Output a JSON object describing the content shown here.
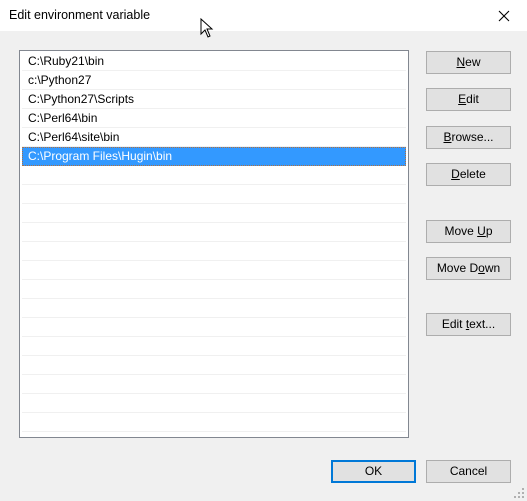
{
  "window": {
    "title": "Edit environment variable",
    "close_icon": "close-icon"
  },
  "list": {
    "items": [
      {
        "label": "C:\\Ruby21\\bin",
        "selected": false
      },
      {
        "label": "c:\\Python27",
        "selected": false
      },
      {
        "label": "C:\\Python27\\Scripts",
        "selected": false
      },
      {
        "label": "C:\\Perl64\\bin",
        "selected": false
      },
      {
        "label": "C:\\Perl64\\site\\bin",
        "selected": false
      },
      {
        "label": "C:\\Program Files\\Hugin\\bin",
        "selected": true
      }
    ],
    "empty_rows": 14,
    "selection_color": "#3399ff"
  },
  "buttons": {
    "new": {
      "pre": "",
      "accel": "N",
      "post": "ew"
    },
    "edit": {
      "pre": "",
      "accel": "E",
      "post": "dit"
    },
    "browse": {
      "pre": "",
      "accel": "B",
      "post": "rowse..."
    },
    "delete": {
      "pre": "",
      "accel": "D",
      "post": "elete"
    },
    "move_up": {
      "pre": "Move ",
      "accel": "U",
      "post": "p"
    },
    "move_down": {
      "pre": "Move D",
      "accel": "o",
      "post": "wn"
    },
    "edit_text": {
      "pre": "Edit ",
      "accel": "t",
      "post": "ext..."
    },
    "ok": {
      "label": "OK"
    },
    "cancel": {
      "label": "Cancel"
    }
  },
  "colors": {
    "accent": "#0078d7",
    "dialog_bg": "#f0f0f0",
    "button_bg": "#e1e1e1"
  }
}
